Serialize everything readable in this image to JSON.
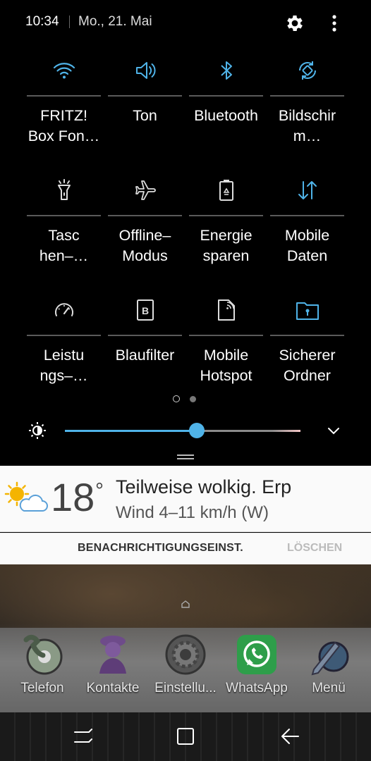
{
  "status": {
    "time": "10:34",
    "date": "Mo., 21. Mai",
    "icons": [
      "settings-icon",
      "more-icon"
    ]
  },
  "tiles": [
    {
      "label": "FRITZ!\nBox Fon…",
      "icon": "wifi-icon",
      "active": true
    },
    {
      "label": "Ton",
      "icon": "volume-icon",
      "active": true
    },
    {
      "label": "Bluetooth",
      "icon": "bluetooth-icon",
      "active": true
    },
    {
      "label": "Bildschir\nm…",
      "icon": "auto-rotate-icon",
      "active": true
    },
    {
      "label": "Tasc\nhen–…",
      "icon": "flashlight-icon",
      "active": false
    },
    {
      "label": "Offline–\nModus",
      "icon": "airplane-icon",
      "active": false
    },
    {
      "label": "Energie\nsparen",
      "icon": "battery-saver-icon",
      "active": false
    },
    {
      "label": "Mobile\nDaten",
      "icon": "mobile-data-icon",
      "active": true
    },
    {
      "label": "Leistu\nngs–…",
      "icon": "performance-icon",
      "active": false
    },
    {
      "label": "Blaufilter",
      "icon": "blue-light-filter-icon",
      "active": false
    },
    {
      "label": "Mobile\nHotspot",
      "icon": "hotspot-icon",
      "active": false
    },
    {
      "label": "Sicherer\nOrdner",
      "icon": "secure-folder-icon",
      "active": true
    }
  ],
  "page_indicator": {
    "current": 1,
    "total": 2
  },
  "brightness": {
    "level": 0.56
  },
  "weather": {
    "temperature": "18",
    "degree": "°",
    "condition": "Teilweise wolkig. Erp",
    "wind": "Wind 4–11 km/h (W)"
  },
  "notification_actions": {
    "settings": "BENACHRICHTIGUNGSEINST.",
    "clear": "LÖSCHEN"
  },
  "dock": [
    {
      "label": "Telefon",
      "icon": "phone-icon"
    },
    {
      "label": "Kontakte",
      "icon": "contacts-icon"
    },
    {
      "label": "Einstellu...",
      "icon": "settings-app-icon"
    },
    {
      "label": "WhatsApp",
      "icon": "whatsapp-icon"
    },
    {
      "label": "Menü",
      "icon": "menu-app-icon"
    }
  ],
  "nav": [
    "recents-icon",
    "home-button-icon",
    "back-icon"
  ],
  "colors": {
    "accent": "#4fb3e8",
    "inactive": "#d8d8d8",
    "panel": "#000000",
    "card": "#fafafa"
  }
}
